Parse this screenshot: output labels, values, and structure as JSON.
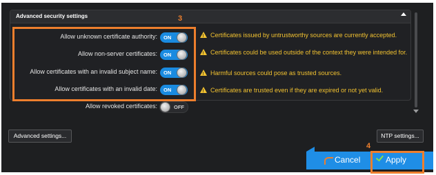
{
  "panel": {
    "title": "Advanced security settings"
  },
  "annotations": {
    "step3": "3",
    "step4": "4"
  },
  "settings": [
    {
      "label": "Allow unknown certificate authority:",
      "state": "ON",
      "warning": "Certificates issued by untrustworthy sources are currently accepted."
    },
    {
      "label": "Allow non-server certificates:",
      "state": "ON",
      "warning": "Certificates could be used outside of the context they were intended for."
    },
    {
      "label": "Allow certificates with an invalid subject name:",
      "state": "ON",
      "warning": "Harmful sources could pose as trusted sources."
    },
    {
      "label": "Allow certificates with an invalid date:",
      "state": "ON",
      "warning": "Certificates are trusted even if they are expired or not yet valid."
    },
    {
      "label": "Allow revoked certificates:",
      "state": "OFF",
      "warning": ""
    }
  ],
  "buttons": {
    "advanced_settings": "Advanced settings...",
    "ntp_settings": "NTP settings...",
    "cancel": "Cancel",
    "apply": "Apply"
  },
  "colors": {
    "accent": "#1f8ee6",
    "annotation": "#ee7f2d",
    "warning": "#f2c230"
  }
}
